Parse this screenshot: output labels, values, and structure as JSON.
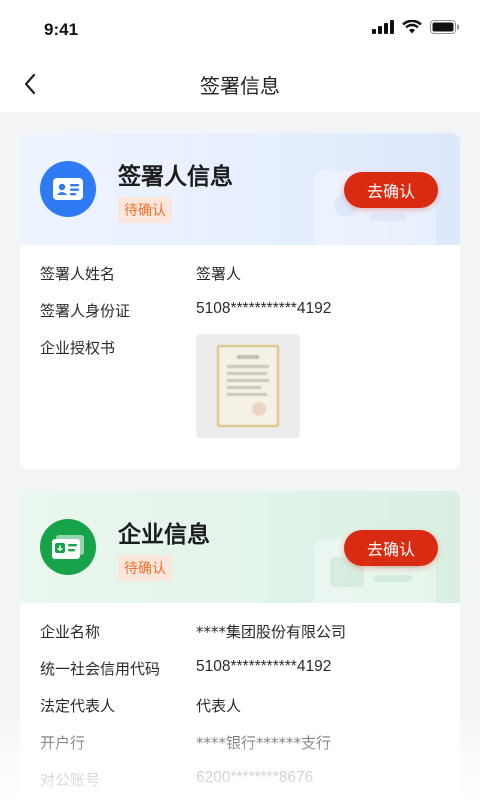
{
  "status_bar": {
    "time": "9:41"
  },
  "nav": {
    "title": "签署信息"
  },
  "signer_card": {
    "title": "签署人信息",
    "badge": "待确认",
    "confirm_label": "去确认",
    "rows": [
      {
        "label": "签署人姓名",
        "value": "签署人"
      },
      {
        "label": "签署人身份证",
        "value": "5108***********4192"
      },
      {
        "label": "企业授权书",
        "value": ""
      }
    ]
  },
  "company_card": {
    "title": "企业信息",
    "badge": "待确认",
    "confirm_label": "去确认",
    "rows": [
      {
        "label": "企业名称",
        "value": "****集团股份有限公司"
      },
      {
        "label": "统一社会信用代码",
        "value": "5108***********4192"
      },
      {
        "label": "法定代表人",
        "value": "代表人"
      },
      {
        "label": "开户行",
        "value": "****银行******支行"
      },
      {
        "label": "对公账号",
        "value": "6200********8676"
      }
    ]
  },
  "colors": {
    "accent_red": "#d92b12",
    "badge_text": "#f0712c",
    "signer_icon": "#2f7af5",
    "company_icon": "#16a34a"
  }
}
